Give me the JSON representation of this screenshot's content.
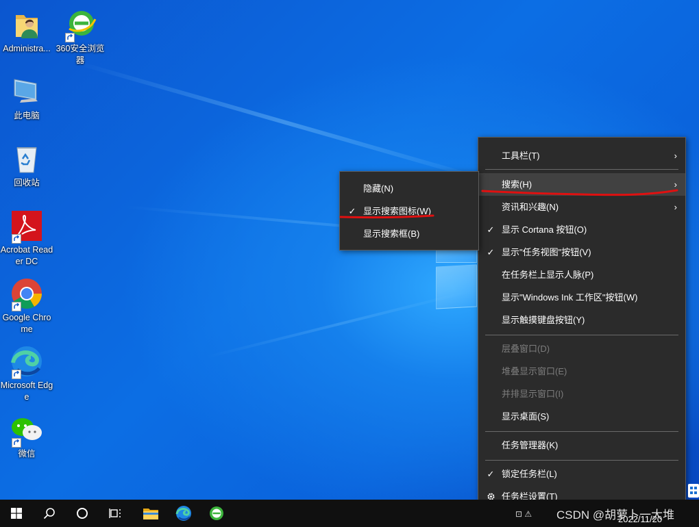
{
  "desktop": {
    "icons": [
      {
        "label": "Administra..."
      },
      {
        "label": "360安全浏览器"
      },
      {
        "label": "此电脑"
      },
      {
        "label": "回收站"
      },
      {
        "label": "Acrobat Reader DC"
      },
      {
        "label": "Google Chrome"
      },
      {
        "label": "Microsoft Edge"
      },
      {
        "label": "微信"
      }
    ]
  },
  "context_menu": {
    "items": [
      {
        "label": "工具栏(T)",
        "submenu": true
      },
      {
        "label": "搜索(H)",
        "submenu": true,
        "highlighted": true
      },
      {
        "label": "资讯和兴趣(N)",
        "submenu": true
      },
      {
        "label": "显示 Cortana 按钮(O)",
        "checked": true
      },
      {
        "label": "显示\"任务视图\"按钮(V)",
        "checked": true
      },
      {
        "label": "在任务栏上显示人脉(P)"
      },
      {
        "label": "显示\"Windows Ink 工作区\"按钮(W)"
      },
      {
        "label": "显示触摸键盘按钮(Y)"
      },
      {
        "label": "层叠窗口(D)",
        "disabled": true
      },
      {
        "label": "堆叠显示窗口(E)",
        "disabled": true
      },
      {
        "label": "并排显示窗口(I)",
        "disabled": true
      },
      {
        "label": "显示桌面(S)"
      },
      {
        "label": "任务管理器(K)"
      },
      {
        "label": "锁定任务栏(L)",
        "checked": true
      },
      {
        "label": "任务栏设置(T)",
        "icon": "gear-icon"
      }
    ],
    "arrow_glyph": "›"
  },
  "search_submenu": {
    "items": [
      {
        "label": "隐藏(N)"
      },
      {
        "label": "显示搜索图标(W)",
        "checked": true
      },
      {
        "label": "显示搜索框(B)"
      }
    ]
  },
  "check_glyph": "✓",
  "taskbar": {
    "buttons": [
      "start-button",
      "search-button",
      "cortana-button",
      "task-view-button",
      "file-explorer-button",
      "edge-button",
      "360-browser-button"
    ],
    "tray": {
      "date": "2022/11/20"
    }
  },
  "watermark": "CSDN @胡萝卜一大堆",
  "colors": {
    "menu_bg": "#2b2b2b",
    "menu_highlight": "#414141",
    "annotation_red": "#e01010",
    "taskbar_bg": "#101010"
  }
}
